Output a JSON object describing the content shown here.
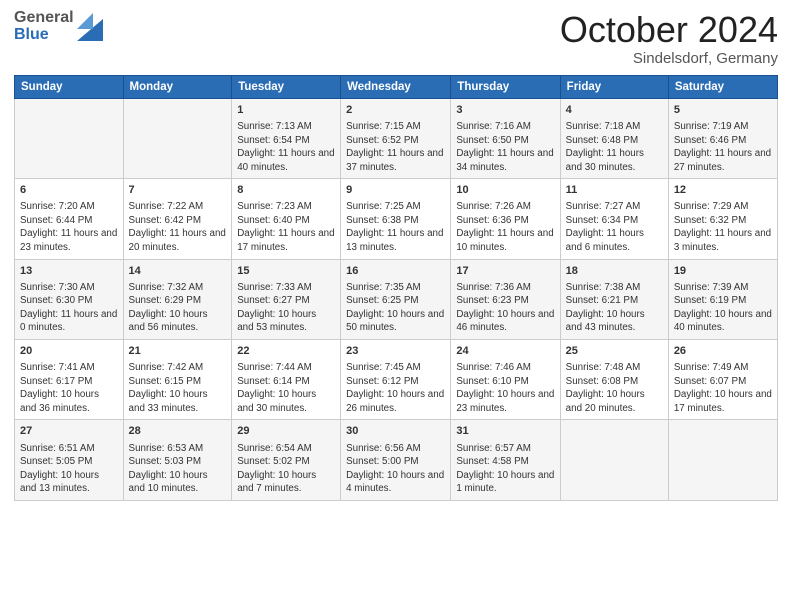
{
  "header": {
    "logo": {
      "general": "General",
      "blue": "Blue"
    },
    "title": "October 2024",
    "location": "Sindelsdorf, Germany"
  },
  "weekdays": [
    "Sunday",
    "Monday",
    "Tuesday",
    "Wednesday",
    "Thursday",
    "Friday",
    "Saturday"
  ],
  "weeks": [
    [
      {
        "day": "",
        "info": ""
      },
      {
        "day": "",
        "info": ""
      },
      {
        "day": "1",
        "info": "Sunrise: 7:13 AM\nSunset: 6:54 PM\nDaylight: 11 hours and 40 minutes."
      },
      {
        "day": "2",
        "info": "Sunrise: 7:15 AM\nSunset: 6:52 PM\nDaylight: 11 hours and 37 minutes."
      },
      {
        "day": "3",
        "info": "Sunrise: 7:16 AM\nSunset: 6:50 PM\nDaylight: 11 hours and 34 minutes."
      },
      {
        "day": "4",
        "info": "Sunrise: 7:18 AM\nSunset: 6:48 PM\nDaylight: 11 hours and 30 minutes."
      },
      {
        "day": "5",
        "info": "Sunrise: 7:19 AM\nSunset: 6:46 PM\nDaylight: 11 hours and 27 minutes."
      }
    ],
    [
      {
        "day": "6",
        "info": "Sunrise: 7:20 AM\nSunset: 6:44 PM\nDaylight: 11 hours and 23 minutes."
      },
      {
        "day": "7",
        "info": "Sunrise: 7:22 AM\nSunset: 6:42 PM\nDaylight: 11 hours and 20 minutes."
      },
      {
        "day": "8",
        "info": "Sunrise: 7:23 AM\nSunset: 6:40 PM\nDaylight: 11 hours and 17 minutes."
      },
      {
        "day": "9",
        "info": "Sunrise: 7:25 AM\nSunset: 6:38 PM\nDaylight: 11 hours and 13 minutes."
      },
      {
        "day": "10",
        "info": "Sunrise: 7:26 AM\nSunset: 6:36 PM\nDaylight: 11 hours and 10 minutes."
      },
      {
        "day": "11",
        "info": "Sunrise: 7:27 AM\nSunset: 6:34 PM\nDaylight: 11 hours and 6 minutes."
      },
      {
        "day": "12",
        "info": "Sunrise: 7:29 AM\nSunset: 6:32 PM\nDaylight: 11 hours and 3 minutes."
      }
    ],
    [
      {
        "day": "13",
        "info": "Sunrise: 7:30 AM\nSunset: 6:30 PM\nDaylight: 11 hours and 0 minutes."
      },
      {
        "day": "14",
        "info": "Sunrise: 7:32 AM\nSunset: 6:29 PM\nDaylight: 10 hours and 56 minutes."
      },
      {
        "day": "15",
        "info": "Sunrise: 7:33 AM\nSunset: 6:27 PM\nDaylight: 10 hours and 53 minutes."
      },
      {
        "day": "16",
        "info": "Sunrise: 7:35 AM\nSunset: 6:25 PM\nDaylight: 10 hours and 50 minutes."
      },
      {
        "day": "17",
        "info": "Sunrise: 7:36 AM\nSunset: 6:23 PM\nDaylight: 10 hours and 46 minutes."
      },
      {
        "day": "18",
        "info": "Sunrise: 7:38 AM\nSunset: 6:21 PM\nDaylight: 10 hours and 43 minutes."
      },
      {
        "day": "19",
        "info": "Sunrise: 7:39 AM\nSunset: 6:19 PM\nDaylight: 10 hours and 40 minutes."
      }
    ],
    [
      {
        "day": "20",
        "info": "Sunrise: 7:41 AM\nSunset: 6:17 PM\nDaylight: 10 hours and 36 minutes."
      },
      {
        "day": "21",
        "info": "Sunrise: 7:42 AM\nSunset: 6:15 PM\nDaylight: 10 hours and 33 minutes."
      },
      {
        "day": "22",
        "info": "Sunrise: 7:44 AM\nSunset: 6:14 PM\nDaylight: 10 hours and 30 minutes."
      },
      {
        "day": "23",
        "info": "Sunrise: 7:45 AM\nSunset: 6:12 PM\nDaylight: 10 hours and 26 minutes."
      },
      {
        "day": "24",
        "info": "Sunrise: 7:46 AM\nSunset: 6:10 PM\nDaylight: 10 hours and 23 minutes."
      },
      {
        "day": "25",
        "info": "Sunrise: 7:48 AM\nSunset: 6:08 PM\nDaylight: 10 hours and 20 minutes."
      },
      {
        "day": "26",
        "info": "Sunrise: 7:49 AM\nSunset: 6:07 PM\nDaylight: 10 hours and 17 minutes."
      }
    ],
    [
      {
        "day": "27",
        "info": "Sunrise: 6:51 AM\nSunset: 5:05 PM\nDaylight: 10 hours and 13 minutes."
      },
      {
        "day": "28",
        "info": "Sunrise: 6:53 AM\nSunset: 5:03 PM\nDaylight: 10 hours and 10 minutes."
      },
      {
        "day": "29",
        "info": "Sunrise: 6:54 AM\nSunset: 5:02 PM\nDaylight: 10 hours and 7 minutes."
      },
      {
        "day": "30",
        "info": "Sunrise: 6:56 AM\nSunset: 5:00 PM\nDaylight: 10 hours and 4 minutes."
      },
      {
        "day": "31",
        "info": "Sunrise: 6:57 AM\nSunset: 4:58 PM\nDaylight: 10 hours and 1 minute."
      },
      {
        "day": "",
        "info": ""
      },
      {
        "day": "",
        "info": ""
      }
    ]
  ]
}
